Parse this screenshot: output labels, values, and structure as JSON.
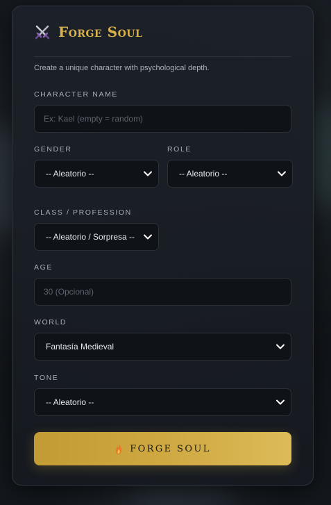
{
  "header": {
    "title": "Forge Soul",
    "subtitle": "Create a unique character with psychological depth."
  },
  "fields": {
    "character_name": {
      "label": "CHARACTER NAME",
      "value": "",
      "placeholder": "Ex: Kael (empty = random)"
    },
    "gender": {
      "label": "GENDER",
      "value": "-- Aleatorio --"
    },
    "role": {
      "label": "ROLE",
      "value": "-- Aleatorio --"
    },
    "class": {
      "label": "CLASS / PROFESSION",
      "value": "-- Aleatorio / Sorpresa --"
    },
    "age": {
      "label": "AGE",
      "value": "",
      "placeholder": "30 (Opcional)"
    },
    "world": {
      "label": "WORLD",
      "value": "Fantasía Medieval"
    },
    "tone": {
      "label": "TONE",
      "value": "-- Aleatorio --"
    }
  },
  "submit": {
    "label": "FORGE SOUL"
  },
  "icons": {
    "title_icon": "crossed-swords-icon",
    "button_icon": "flame-icon",
    "select_icon": "chevron-down-icon"
  },
  "colors": {
    "accent_gold": "#d8b14a",
    "card_bg": "#1c2028",
    "input_bg": "#0f1217"
  }
}
